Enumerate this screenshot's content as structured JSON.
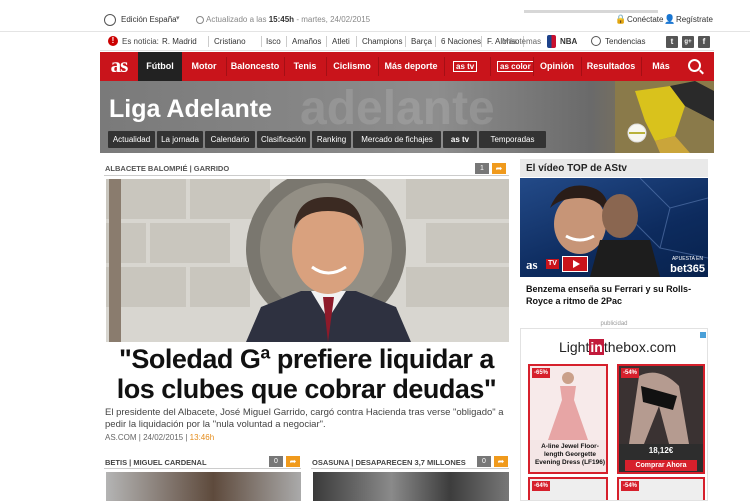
{
  "topbar": {
    "edition": "Edición España",
    "updated_prefix": "Actualizado a las",
    "updated_time": "15:45h",
    "updated_date": "- martes, 24/02/2015",
    "login": "Conéctate",
    "register": "Regístrate"
  },
  "ticker": {
    "label": "Es noticia:",
    "items": [
      "R. Madrid",
      "Cristiano",
      "Isco",
      "Amaños",
      "Atleti",
      "Champions",
      "Barça",
      "6 Naciones",
      "F. Alonso",
      "Más temas"
    ],
    "nba": "NBA",
    "trends": "Tendencias",
    "social_twitter": "t",
    "social_gplus": "g+",
    "social_facebook": "f"
  },
  "nav": {
    "logo": "as",
    "items": [
      "Fútbol",
      "Motor",
      "Baloncesto",
      "Tenis",
      "Ciclismo",
      "Más deporte",
      "Opinión",
      "Resultados",
      "Más"
    ],
    "tv": "as tv",
    "color": "as color"
  },
  "section": {
    "title": "Liga Adelante",
    "ghost": "adelante",
    "subnav": [
      "Actualidad",
      "La jornada",
      "Calendario",
      "Clasificación",
      "Ranking",
      "Mercado de fichajes",
      "as tv",
      "Temporadas"
    ]
  },
  "main": {
    "kicker": "ALBACETE BALOMPIÉ | GARRIDO",
    "comments": "1",
    "headline": "\"Soledad Gª prefiere liquidar a los clubes que cobrar deudas\"",
    "lede": "El presidente del Albacete, José Miguel Garrido, cargó contra Hacienda tras verse \"obligado\" a pedir la liquidación por la \"nula voluntad a negociar\".",
    "source": "AS.COM",
    "date": "24/02/2015",
    "time": "13:46h"
  },
  "sub": [
    {
      "kicker": "BETIS | MIGUEL CARDENAL",
      "comments": "0"
    },
    {
      "kicker": "OSASUNA | DESAPARECEN 3,7 MILLONES",
      "comments": "0"
    }
  ],
  "sidebar": {
    "video_title": "El vídeo TOP de AStv",
    "video_logo": "as",
    "video_tv": "TV",
    "sponsor_label": "APUESTA EN",
    "sponsor": "bet365",
    "video_caption": "Benzema enseña su Ferrari y su Rolls-Royce a ritmo de 2Pac",
    "ad_label": "publicidad",
    "ad_brand_pre": "Light",
    "ad_brand_in": "in",
    "ad_brand_post": "thebox.com",
    "prod1_pct": "-65%",
    "prod1_text": "A-line Jewel Floor-length Georgette Evening Dress (LF196)",
    "prod2_pct": "-54%",
    "prod2_price": "18,12€",
    "prod2_buy": "Comprar Ahora",
    "row2_pct1": "-64%",
    "row2_pct2": "-54%"
  },
  "colors": {
    "brand_red": "#c9141b",
    "accent_orange": "#f09a1c",
    "dark_nav": "#222222"
  }
}
